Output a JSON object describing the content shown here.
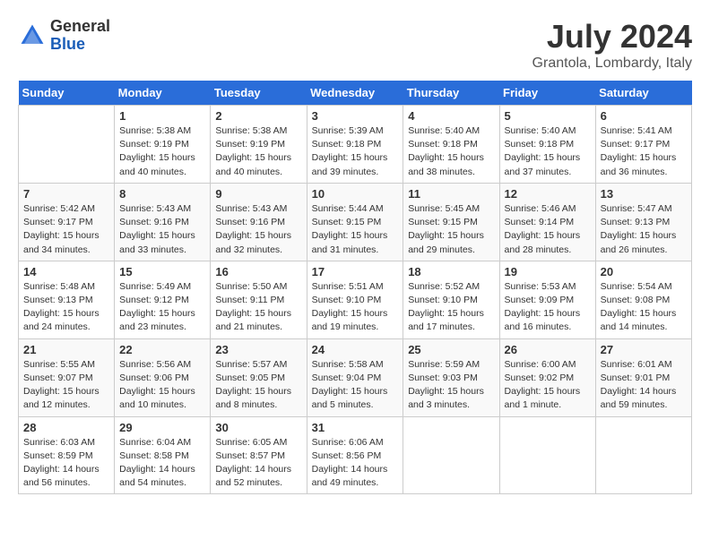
{
  "header": {
    "logo_line1": "General",
    "logo_line2": "Blue",
    "month_year": "July 2024",
    "location": "Grantola, Lombardy, Italy"
  },
  "weekdays": [
    "Sunday",
    "Monday",
    "Tuesday",
    "Wednesday",
    "Thursday",
    "Friday",
    "Saturday"
  ],
  "weeks": [
    [
      {
        "day": "",
        "info": ""
      },
      {
        "day": "1",
        "info": "Sunrise: 5:38 AM\nSunset: 9:19 PM\nDaylight: 15 hours\nand 40 minutes."
      },
      {
        "day": "2",
        "info": "Sunrise: 5:38 AM\nSunset: 9:19 PM\nDaylight: 15 hours\nand 40 minutes."
      },
      {
        "day": "3",
        "info": "Sunrise: 5:39 AM\nSunset: 9:18 PM\nDaylight: 15 hours\nand 39 minutes."
      },
      {
        "day": "4",
        "info": "Sunrise: 5:40 AM\nSunset: 9:18 PM\nDaylight: 15 hours\nand 38 minutes."
      },
      {
        "day": "5",
        "info": "Sunrise: 5:40 AM\nSunset: 9:18 PM\nDaylight: 15 hours\nand 37 minutes."
      },
      {
        "day": "6",
        "info": "Sunrise: 5:41 AM\nSunset: 9:17 PM\nDaylight: 15 hours\nand 36 minutes."
      }
    ],
    [
      {
        "day": "7",
        "info": "Sunrise: 5:42 AM\nSunset: 9:17 PM\nDaylight: 15 hours\nand 34 minutes."
      },
      {
        "day": "8",
        "info": "Sunrise: 5:43 AM\nSunset: 9:16 PM\nDaylight: 15 hours\nand 33 minutes."
      },
      {
        "day": "9",
        "info": "Sunrise: 5:43 AM\nSunset: 9:16 PM\nDaylight: 15 hours\nand 32 minutes."
      },
      {
        "day": "10",
        "info": "Sunrise: 5:44 AM\nSunset: 9:15 PM\nDaylight: 15 hours\nand 31 minutes."
      },
      {
        "day": "11",
        "info": "Sunrise: 5:45 AM\nSunset: 9:15 PM\nDaylight: 15 hours\nand 29 minutes."
      },
      {
        "day": "12",
        "info": "Sunrise: 5:46 AM\nSunset: 9:14 PM\nDaylight: 15 hours\nand 28 minutes."
      },
      {
        "day": "13",
        "info": "Sunrise: 5:47 AM\nSunset: 9:13 PM\nDaylight: 15 hours\nand 26 minutes."
      }
    ],
    [
      {
        "day": "14",
        "info": "Sunrise: 5:48 AM\nSunset: 9:13 PM\nDaylight: 15 hours\nand 24 minutes."
      },
      {
        "day": "15",
        "info": "Sunrise: 5:49 AM\nSunset: 9:12 PM\nDaylight: 15 hours\nand 23 minutes."
      },
      {
        "day": "16",
        "info": "Sunrise: 5:50 AM\nSunset: 9:11 PM\nDaylight: 15 hours\nand 21 minutes."
      },
      {
        "day": "17",
        "info": "Sunrise: 5:51 AM\nSunset: 9:10 PM\nDaylight: 15 hours\nand 19 minutes."
      },
      {
        "day": "18",
        "info": "Sunrise: 5:52 AM\nSunset: 9:10 PM\nDaylight: 15 hours\nand 17 minutes."
      },
      {
        "day": "19",
        "info": "Sunrise: 5:53 AM\nSunset: 9:09 PM\nDaylight: 15 hours\nand 16 minutes."
      },
      {
        "day": "20",
        "info": "Sunrise: 5:54 AM\nSunset: 9:08 PM\nDaylight: 15 hours\nand 14 minutes."
      }
    ],
    [
      {
        "day": "21",
        "info": "Sunrise: 5:55 AM\nSunset: 9:07 PM\nDaylight: 15 hours\nand 12 minutes."
      },
      {
        "day": "22",
        "info": "Sunrise: 5:56 AM\nSunset: 9:06 PM\nDaylight: 15 hours\nand 10 minutes."
      },
      {
        "day": "23",
        "info": "Sunrise: 5:57 AM\nSunset: 9:05 PM\nDaylight: 15 hours\nand 8 minutes."
      },
      {
        "day": "24",
        "info": "Sunrise: 5:58 AM\nSunset: 9:04 PM\nDaylight: 15 hours\nand 5 minutes."
      },
      {
        "day": "25",
        "info": "Sunrise: 5:59 AM\nSunset: 9:03 PM\nDaylight: 15 hours\nand 3 minutes."
      },
      {
        "day": "26",
        "info": "Sunrise: 6:00 AM\nSunset: 9:02 PM\nDaylight: 15 hours\nand 1 minute."
      },
      {
        "day": "27",
        "info": "Sunrise: 6:01 AM\nSunset: 9:01 PM\nDaylight: 14 hours\nand 59 minutes."
      }
    ],
    [
      {
        "day": "28",
        "info": "Sunrise: 6:03 AM\nSunset: 8:59 PM\nDaylight: 14 hours\nand 56 minutes."
      },
      {
        "day": "29",
        "info": "Sunrise: 6:04 AM\nSunset: 8:58 PM\nDaylight: 14 hours\nand 54 minutes."
      },
      {
        "day": "30",
        "info": "Sunrise: 6:05 AM\nSunset: 8:57 PM\nDaylight: 14 hours\nand 52 minutes."
      },
      {
        "day": "31",
        "info": "Sunrise: 6:06 AM\nSunset: 8:56 PM\nDaylight: 14 hours\nand 49 minutes."
      },
      {
        "day": "",
        "info": ""
      },
      {
        "day": "",
        "info": ""
      },
      {
        "day": "",
        "info": ""
      }
    ]
  ]
}
